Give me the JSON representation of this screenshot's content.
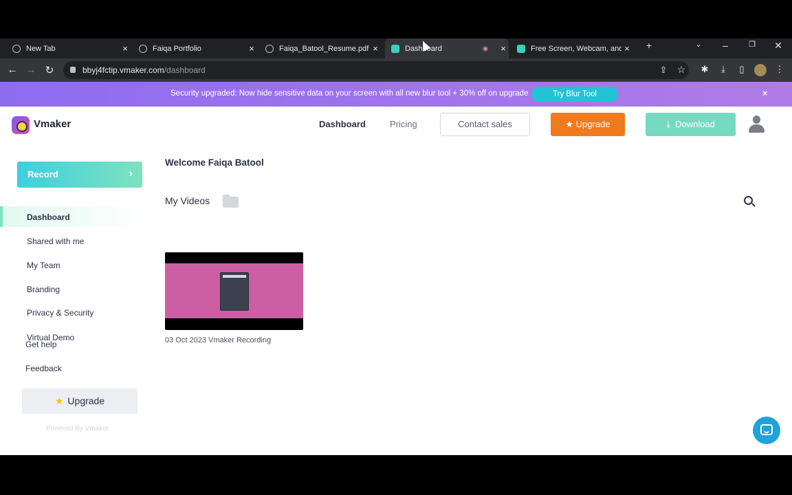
{
  "browser": {
    "tabs": [
      {
        "title": "New Tab",
        "favicon": "chrome-icon"
      },
      {
        "title": "Faiqa Portfolio",
        "favicon": "globe-icon"
      },
      {
        "title": "Faiqa_Batool_Resume.pdf",
        "favicon": "globe-icon"
      },
      {
        "title": "Dashboard",
        "favicon": "vmaker-icon",
        "active": true,
        "recording": true
      },
      {
        "title": "Free Screen, Webcam, and V",
        "favicon": "vmaker-icon"
      }
    ],
    "new_tab_glyph": "+",
    "url_host": "bbyj4fctip.vmaker.com",
    "url_path": "/dashboard"
  },
  "banner": {
    "message": "Security upgraded: Now hide sensitive data on your screen with all new blur tool + 30% off on upgrade",
    "cta": "Try Blur Tool",
    "close": "×",
    "color": "#9b6dea"
  },
  "header": {
    "logo": "Vmaker",
    "nav": [
      "Dashboard",
      "Pricing"
    ],
    "contact": "Contact sales",
    "upgrade": "Upgrade",
    "download": "Download",
    "upgrade_color": "#f07a1e",
    "download_color": "#76d9c2"
  },
  "sidebar": {
    "record": "Record",
    "items": [
      {
        "label": "Dashboard",
        "active": true
      },
      {
        "label": "Shared with me"
      },
      {
        "label": "My Team"
      },
      {
        "label": "Branding"
      },
      {
        "label": "Privacy & Security"
      },
      {
        "label": "Virtual Demo"
      }
    ],
    "get_help": "Get help",
    "feedback": "Feedback",
    "upgrade": "Upgrade",
    "powered": "Powered By Vmaker"
  },
  "main": {
    "welcome": "Welcome Faiqa Batool",
    "section_title": "My Videos",
    "videos": [
      {
        "caption": "03 Oct 2023 Vmaker Recording"
      }
    ]
  }
}
